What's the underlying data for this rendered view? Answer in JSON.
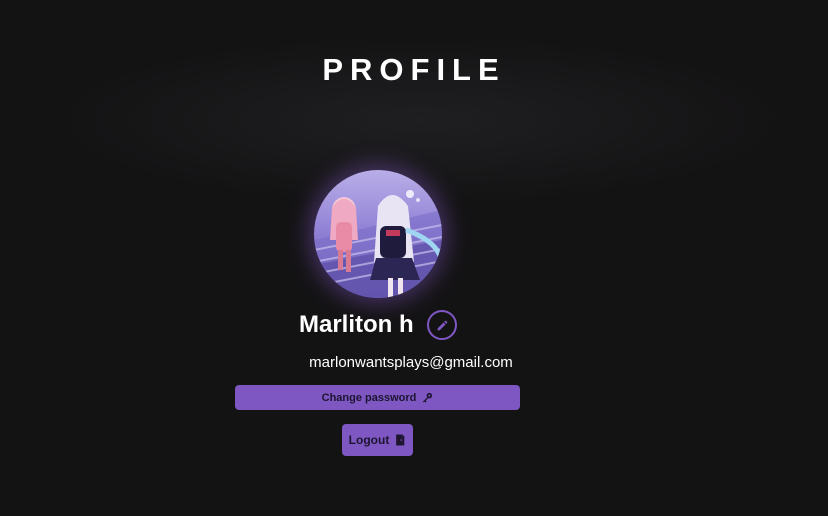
{
  "page": {
    "title": "PROFILE"
  },
  "profile": {
    "name": "Marliton h",
    "email": "marlonwantsplays@gmail.com"
  },
  "actions": {
    "change_password_label": "Change password",
    "logout_label": "Logout"
  },
  "icons": {
    "edit": "pencil-icon",
    "change_password": "key-icon",
    "logout": "door-icon"
  },
  "colors": {
    "background": "#141314",
    "accent": "#7e57c2",
    "button_text": "#1d1530",
    "text": "#ffffff"
  }
}
